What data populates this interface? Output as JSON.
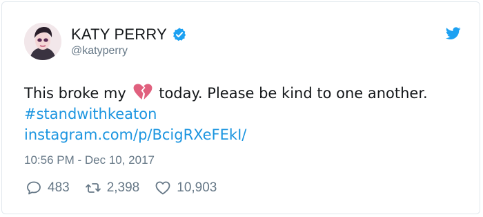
{
  "tweet": {
    "author": {
      "display_name": "KATY PERRY",
      "handle": "@katyperry",
      "avatar_icon": "avatar-photo",
      "verified_icon": "verified-badge-icon"
    },
    "brand_icon": "twitter-bird-icon",
    "text_before_emoji": "This broke my",
    "emoji": "broken-heart-icon",
    "text_after_emoji": "today. Please be kind to one another.",
    "hashtag": "#standwithkeaton",
    "url": "instagram.com/p/BcigRXeFEkI/",
    "timestamp": "10:56 PM - Dec 10, 2017",
    "stats": {
      "replies": "483",
      "retweets": "2,398",
      "likes": "10,903"
    },
    "colors": {
      "link": "#1b95e0",
      "muted": "#657786",
      "text": "#14171a",
      "verified": "#1da1f2",
      "broken_heart": "#e0607e"
    }
  }
}
